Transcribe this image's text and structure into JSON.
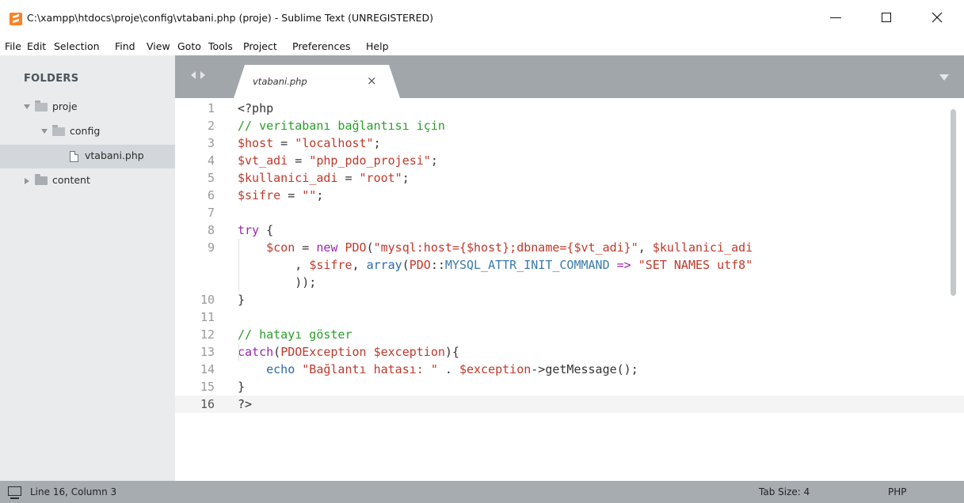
{
  "window": {
    "title": "C:\\xampp\\htdocs\\proje\\config\\vtabani.php (proje) - Sublime Text (UNREGISTERED)",
    "minimize": "—",
    "close": "✕"
  },
  "menu": {
    "items": [
      "File",
      "Edit",
      "Selection",
      "Find",
      "View",
      "Goto",
      "Tools",
      "Project",
      "Preferences",
      "Help"
    ]
  },
  "sidebar": {
    "title": "FOLDERS",
    "tree": [
      {
        "label": "proje",
        "type": "folder",
        "expanded": true
      },
      {
        "label": "config",
        "type": "folder",
        "expanded": true
      },
      {
        "label": "vtabani.php",
        "type": "file",
        "selected": true
      },
      {
        "label": "content",
        "type": "folder",
        "expanded": false
      }
    ]
  },
  "tabs": {
    "active_label": "vtabani.php",
    "close_glyph": "×"
  },
  "editor": {
    "current_line": 16,
    "lines": [
      {
        "num": "1",
        "tokens": [
          {
            "t": "<?php",
            "c": "op"
          }
        ]
      },
      {
        "num": "2",
        "tokens": [
          {
            "t": "// veritabanı bağlantısı için",
            "c": "cmt"
          }
        ]
      },
      {
        "num": "3",
        "tokens": [
          {
            "t": "$host",
            "c": "var"
          },
          {
            "t": " = ",
            "c": "op"
          },
          {
            "t": "\"localhost\"",
            "c": "str"
          },
          {
            "t": ";",
            "c": "op"
          }
        ]
      },
      {
        "num": "4",
        "tokens": [
          {
            "t": "$vt_adi",
            "c": "var"
          },
          {
            "t": " = ",
            "c": "op"
          },
          {
            "t": "\"php_pdo_projesi\"",
            "c": "str"
          },
          {
            "t": ";",
            "c": "op"
          }
        ]
      },
      {
        "num": "5",
        "tokens": [
          {
            "t": "$kullanici_adi",
            "c": "var"
          },
          {
            "t": " = ",
            "c": "op"
          },
          {
            "t": "\"root\"",
            "c": "str"
          },
          {
            "t": ";",
            "c": "op"
          }
        ]
      },
      {
        "num": "6",
        "tokens": [
          {
            "t": "$sifre",
            "c": "var"
          },
          {
            "t": " = ",
            "c": "op"
          },
          {
            "t": "\"\"",
            "c": "str"
          },
          {
            "t": ";",
            "c": "op"
          }
        ]
      },
      {
        "num": "7",
        "tokens": []
      },
      {
        "num": "8",
        "tokens": [
          {
            "t": "try",
            "c": "kw"
          },
          {
            "t": " {",
            "c": "op"
          }
        ]
      },
      {
        "num": "9",
        "tokens": [
          {
            "t": "    ",
            "c": "op"
          },
          {
            "t": "$con",
            "c": "var"
          },
          {
            "t": " = ",
            "c": "op"
          },
          {
            "t": "new",
            "c": "kw"
          },
          {
            "t": " ",
            "c": "op"
          },
          {
            "t": "PDO",
            "c": "cls"
          },
          {
            "t": "(",
            "c": "op"
          },
          {
            "t": "\"mysql:host={$host};dbname={$vt_adi}\"",
            "c": "str"
          },
          {
            "t": ", ",
            "c": "op"
          },
          {
            "t": "$kullanici_adi",
            "c": "var"
          }
        ]
      },
      {
        "num": "",
        "tokens": [
          {
            "t": "        , ",
            "c": "op"
          },
          {
            "t": "$sifre",
            "c": "var"
          },
          {
            "t": ", ",
            "c": "op"
          },
          {
            "t": "array",
            "c": "fn"
          },
          {
            "t": "(",
            "c": "op"
          },
          {
            "t": "PDO",
            "c": "cls"
          },
          {
            "t": "::",
            "c": "op"
          },
          {
            "t": "MYSQL_ATTR_INIT_COMMAND",
            "c": "cst"
          },
          {
            "t": " => ",
            "c": "kw"
          },
          {
            "t": "\"SET NAMES utf8\"",
            "c": "str"
          }
        ]
      },
      {
        "num": "",
        "tokens": [
          {
            "t": "        ));",
            "c": "op"
          }
        ]
      },
      {
        "num": "10",
        "tokens": [
          {
            "t": "}",
            "c": "op"
          }
        ]
      },
      {
        "num": "11",
        "tokens": []
      },
      {
        "num": "12",
        "tokens": [
          {
            "t": "// hatayı göster",
            "c": "cmt"
          }
        ]
      },
      {
        "num": "13",
        "tokens": [
          {
            "t": "catch",
            "c": "kw"
          },
          {
            "t": "(",
            "c": "op"
          },
          {
            "t": "PDOException",
            "c": "cls"
          },
          {
            "t": " ",
            "c": "op"
          },
          {
            "t": "$exception",
            "c": "var"
          },
          {
            "t": "){",
            "c": "op"
          }
        ]
      },
      {
        "num": "14",
        "tokens": [
          {
            "t": "    ",
            "c": "op"
          },
          {
            "t": "echo",
            "c": "fn"
          },
          {
            "t": " ",
            "c": "op"
          },
          {
            "t": "\"Bağlantı hatası: \"",
            "c": "str"
          },
          {
            "t": " . ",
            "c": "op"
          },
          {
            "t": "$exception",
            "c": "var"
          },
          {
            "t": "->getMessage();",
            "c": "op"
          }
        ]
      },
      {
        "num": "15",
        "tokens": [
          {
            "t": "}",
            "c": "op"
          }
        ]
      },
      {
        "num": "16",
        "tokens": [
          {
            "t": "?>",
            "c": "op"
          }
        ]
      }
    ]
  },
  "status": {
    "position": "Line 16, Column 3",
    "tab_size": "Tab Size: 4",
    "syntax": "PHP"
  },
  "colors": {
    "sidebar_bg": "#e9ebed",
    "tabbar_bg": "#a1a6ab",
    "statusbar_bg": "#a7acb1",
    "accent_icon": "#ff7f22"
  }
}
